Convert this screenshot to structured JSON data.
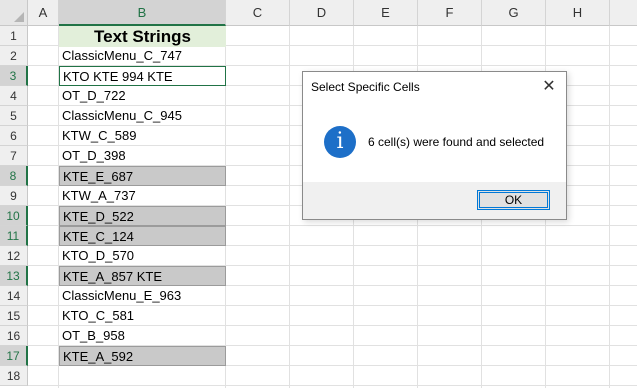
{
  "columns": [
    "A",
    "B",
    "C",
    "D",
    "E",
    "F",
    "G",
    "H"
  ],
  "rows": [
    "1",
    "2",
    "3",
    "4",
    "5",
    "6",
    "7",
    "8",
    "9",
    "10",
    "11",
    "12",
    "13",
    "14",
    "15",
    "16",
    "17",
    "18"
  ],
  "cells": [
    "Text Strings",
    "ClassicMenu_C_747",
    "KTO  KTE  994  KTE",
    "OT_D_722",
    "ClassicMenu_C_945",
    "KTW_C_589",
    "OT_D_398",
    "KTE_E_687",
    "KTW_A_737",
    "KTE_D_522",
    "KTE_C_124",
    "KTO_D_570",
    "KTE_A_857 KTE",
    "ClassicMenu_E_963",
    "KTO_C_581",
    "OT_B_958",
    "KTE_A_592"
  ],
  "dialog": {
    "title": "Select Specific Cells",
    "close_glyph": "✕",
    "info_glyph": "i",
    "message": "6 cell(s) were found and selected",
    "ok_label": "OK"
  },
  "colors": {
    "header_fill": "#e2efda",
    "selected_fill": "#c9c9c9",
    "accent": "#217346",
    "info_blue": "#1d6fc8"
  }
}
